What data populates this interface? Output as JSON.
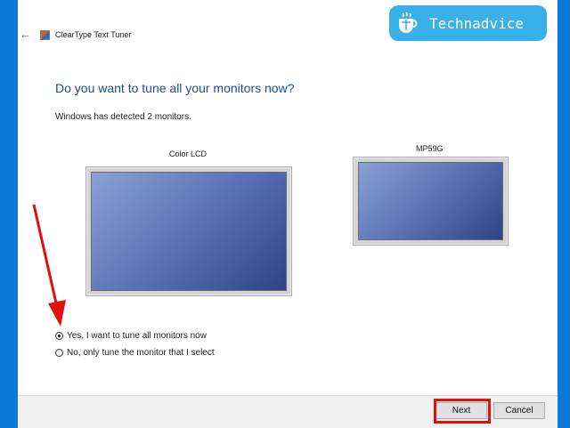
{
  "window": {
    "back_icon": "back-arrow-icon",
    "app_icon": "cleartype-app-icon",
    "title": "ClearType Text Tuner"
  },
  "main": {
    "heading": "Do you want to tune all your monitors now?",
    "detected_text": "Windows has detected 2 monitors.",
    "monitors": [
      {
        "label": "Color LCD"
      },
      {
        "label": "MP59G"
      }
    ],
    "options": [
      {
        "label": "Yes, I want to tune all monitors now",
        "selected": true
      },
      {
        "label": "No, only tune the monitor that I select",
        "selected": false
      }
    ]
  },
  "footer": {
    "next_label": "Next",
    "cancel_label": "Cancel"
  },
  "annotations": {
    "arrow_color": "#e01010",
    "highlight_color": "#e01010"
  },
  "watermark": {
    "text": "Technadvice",
    "icon": "technadvice-logo-icon",
    "color": "#3ab0e8"
  },
  "colors": {
    "background": "#0a7ad6",
    "heading": "#1a4f8f"
  }
}
